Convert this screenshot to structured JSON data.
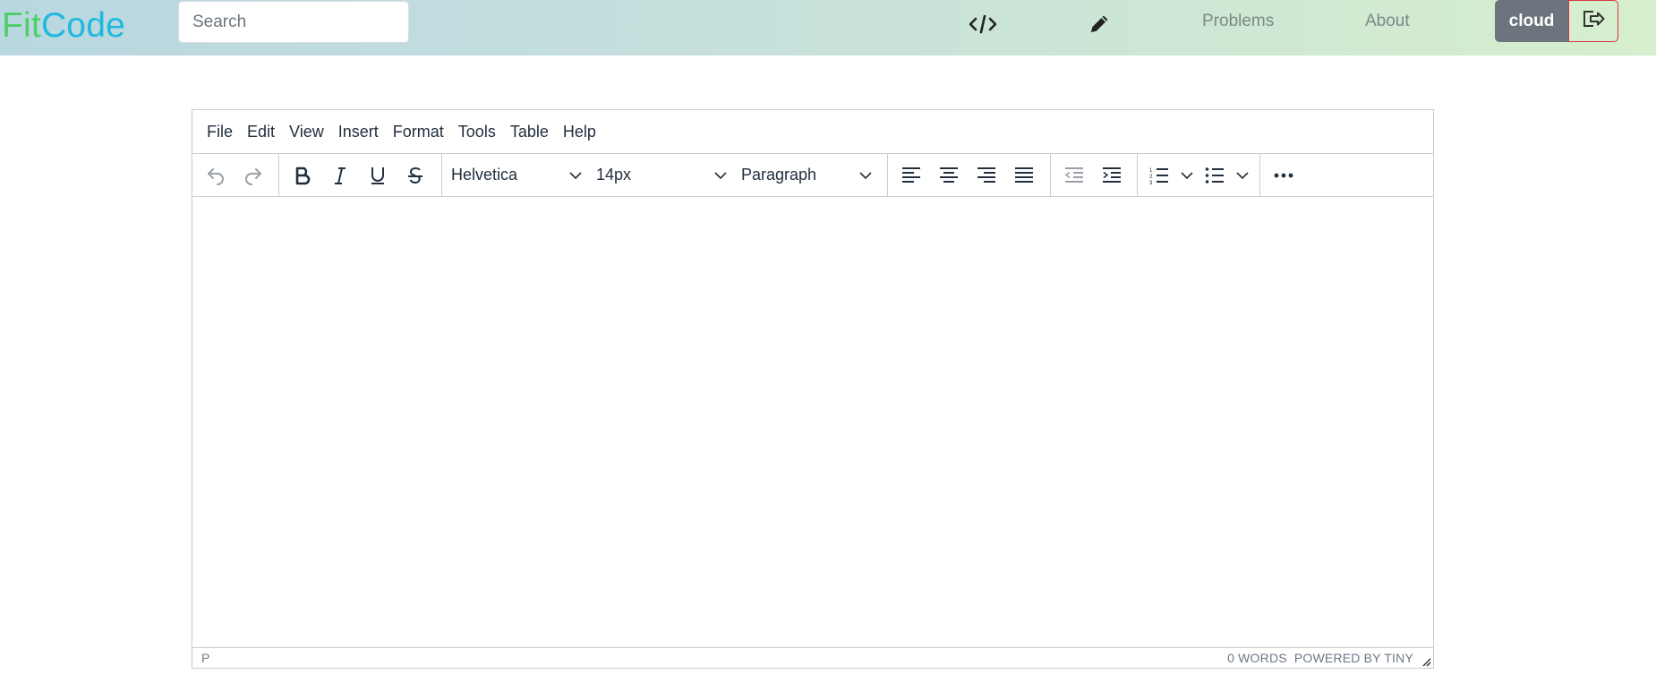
{
  "brand": {
    "part1": "Fit",
    "part2": "Code"
  },
  "search": {
    "placeholder": "Search"
  },
  "nav": {
    "code_icon": "code-icon",
    "edit_icon": "pencil-icon",
    "problems": "Problems",
    "about": "About",
    "user": "cloud",
    "logout_icon": "logout-icon"
  },
  "colors": {
    "brand_green": "#4fcf66",
    "brand_blue": "#20b8df",
    "user_badge": "#6c757d",
    "logout_border": "#dc3545"
  },
  "editor": {
    "menu": [
      "File",
      "Edit",
      "View",
      "Insert",
      "Format",
      "Tools",
      "Table",
      "Help"
    ],
    "toolbar": {
      "font_family": "Helvetica",
      "font_size": "14px",
      "block_format": "Paragraph"
    },
    "status": {
      "path": "P",
      "word_count": "0 WORDS",
      "branding": "POWERED BY TINY"
    }
  }
}
